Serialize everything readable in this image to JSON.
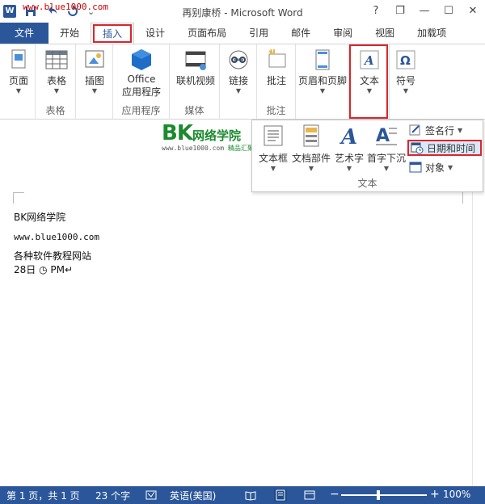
{
  "watermark": "www.blue1000.com",
  "window": {
    "title": "再别康桥 - Microsoft Word",
    "help": "?",
    "restore": "❐",
    "minimize": "—",
    "maximize": "☐",
    "close": "✕"
  },
  "qat": {
    "save_icon": "save-icon",
    "undo_icon": "undo-icon",
    "redo_icon": "redo-icon",
    "customize": "⌄"
  },
  "tabs": [
    {
      "label": "文件"
    },
    {
      "label": "开始"
    },
    {
      "label": "插入"
    },
    {
      "label": "设计"
    },
    {
      "label": "页面布局"
    },
    {
      "label": "引用"
    },
    {
      "label": "邮件"
    },
    {
      "label": "审阅"
    },
    {
      "label": "视图"
    },
    {
      "label": "加载项"
    }
  ],
  "ribbon": {
    "groups": [
      {
        "label": "",
        "buttons": [
          {
            "label": "页面"
          }
        ]
      },
      {
        "label": "表格",
        "buttons": [
          {
            "label": "表格"
          }
        ]
      },
      {
        "label": "",
        "buttons": [
          {
            "label": "插图"
          }
        ]
      },
      {
        "label": "应用程序",
        "buttons": [
          {
            "label": "Office",
            "label2": "应用程序"
          }
        ]
      },
      {
        "label": "媒体",
        "buttons": [
          {
            "label": "联机视频"
          }
        ]
      },
      {
        "label": "",
        "buttons": [
          {
            "label": "链接"
          }
        ]
      },
      {
        "label": "批注",
        "buttons": [
          {
            "label": "批注"
          }
        ]
      },
      {
        "label": "",
        "buttons": [
          {
            "label": "页眉和页脚"
          }
        ]
      },
      {
        "label": "",
        "buttons": [
          {
            "label": "文本"
          }
        ]
      },
      {
        "label": "",
        "buttons": [
          {
            "label": "符号"
          }
        ]
      }
    ]
  },
  "dropdown": {
    "group_label": "文本",
    "buttons": [
      {
        "label": "文本框"
      },
      {
        "label": "文档部件"
      },
      {
        "label": "艺术字"
      },
      {
        "label": "首字下沉"
      }
    ],
    "small": [
      {
        "label": "签名行"
      },
      {
        "label": "日期和时间"
      },
      {
        "label": "对象"
      }
    ]
  },
  "logo": {
    "bk": "BK",
    "cn": "网络学院",
    "url": "www.blue1000.com",
    "tag": "精品汇聚"
  },
  "document": {
    "lines": [
      "BK网络学院",
      "www.blue1000.com",
      "各种软件教程网站",
      "28日  ◷ PM↵"
    ]
  },
  "status": {
    "page": "第 1 页，共 1 页",
    "words": "23 个字",
    "lang": "英语(美国)",
    "zoom": "100%",
    "minus": "−",
    "plus": "+"
  }
}
